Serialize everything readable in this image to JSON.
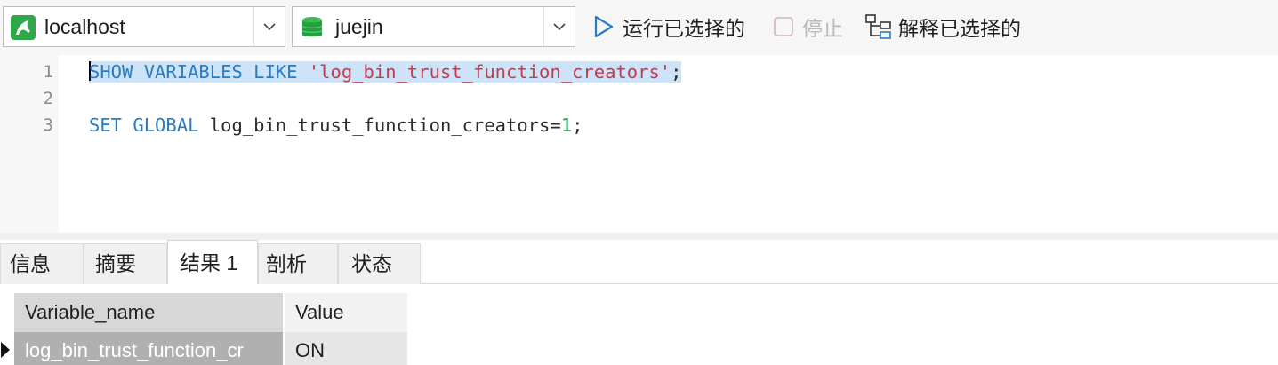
{
  "toolbar": {
    "connection": {
      "value": "localhost",
      "icon": "mysql-connection-icon"
    },
    "database": {
      "value": "juejin",
      "icon": "database-icon"
    },
    "run_selected_label": "运行已选择的",
    "stop_label": "停止",
    "explain_selected_label": "解释已选择的"
  },
  "editor": {
    "line_numbers": [
      "1",
      "2",
      "3"
    ],
    "lines": [
      {
        "kw1": "SHOW VARIABLES LIKE",
        "str": "'log_bin_trust_function_creators'",
        "end": ";"
      },
      {
        "text": ""
      },
      {
        "kw1": "SET GLOBAL",
        "plain": "log_bin_trust_function_creators=",
        "num": "1",
        "end": ";"
      }
    ]
  },
  "tabs": [
    {
      "label": "信息",
      "active": false
    },
    {
      "label": "摘要",
      "active": false
    },
    {
      "label": "结果 1",
      "active": true
    },
    {
      "label": "剖析",
      "active": false
    },
    {
      "label": "状态",
      "active": false
    }
  ],
  "results": {
    "columns": [
      "Variable_name",
      "Value"
    ],
    "rows": [
      [
        "log_bin_trust_function_cr",
        "ON"
      ]
    ]
  },
  "colors": {
    "keyword": "#2a7dc4",
    "string": "#c8394f",
    "number": "#2aa35a",
    "selection": "#cde3f7"
  }
}
